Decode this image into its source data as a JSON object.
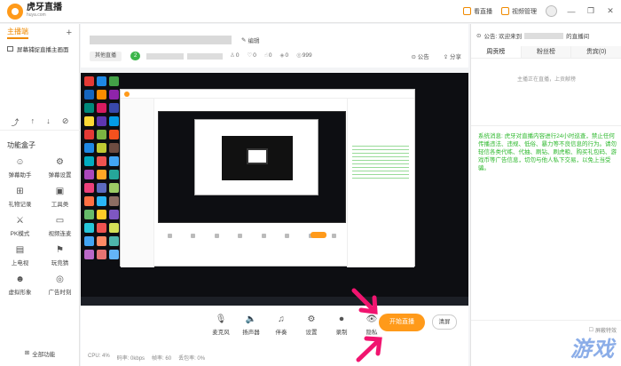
{
  "app": {
    "name": "虎牙直播",
    "url": "huya.com"
  },
  "topbar": {
    "my_live": "看直播",
    "video_manage": "视频管理",
    "win_minimize": "—",
    "win_restore": "❐",
    "win_close": "✕"
  },
  "sidebar": {
    "title": "主播端",
    "add": "+",
    "scene_label": "屏幕捕捉直播主画面",
    "tools": [
      "⤴",
      "↑",
      "↓",
      "⊘"
    ],
    "func_title": "功能盒子",
    "func_items": [
      {
        "label": "弹幕助手",
        "icon": "☺"
      },
      {
        "label": "弹幕设置",
        "icon": "⚙"
      },
      {
        "label": "礼物记录",
        "icon": "⊞"
      },
      {
        "label": "工具类",
        "icon": "▣"
      },
      {
        "label": "PK模式",
        "icon": "⚔"
      },
      {
        "label": "视频连麦",
        "icon": "▭"
      },
      {
        "label": "上电视",
        "icon": "▤"
      },
      {
        "label": "玩竞猜",
        "icon": "⚑"
      },
      {
        "label": "虚拟形象",
        "icon": "☻"
      },
      {
        "label": "广告时刻",
        "icon": "◎"
      }
    ],
    "all_funcs": "全部功能"
  },
  "info": {
    "edit": "编辑",
    "category": "其他直播",
    "level": "2",
    "stats": [
      "0",
      "0",
      "0",
      "0",
      "999"
    ],
    "notice_btn": "公告",
    "share_btn": "分享"
  },
  "toolbar": {
    "tools": [
      {
        "label": "麦克风",
        "icon": "🎙"
      },
      {
        "label": "扬声器",
        "icon": "🔈"
      },
      {
        "label": "伴奏",
        "icon": "♫"
      },
      {
        "label": "设置",
        "icon": "⚙"
      },
      {
        "label": "录制",
        "icon": "⏺"
      },
      {
        "label": "隐私",
        "icon": "👁"
      }
    ],
    "start_label": "开始直播",
    "clear_label": "清屏",
    "status": [
      "CPU: 4%",
      "码率: 0kbps",
      "帧率: 60",
      "丢包率: 0%"
    ]
  },
  "right": {
    "notice_prefix": "公告: 欢迎来到",
    "notice_suffix": "的直播间",
    "tabs": [
      "周贡榜",
      "粉丝榜",
      "贵宾(0)"
    ],
    "rank_empty": "主播正在直播，上贡献榜",
    "system_message": "系统消息: 虎牙对直播内容进行24小时巡查，禁止任何传播违法、违规、低俗、暴力等不良信息的行为。请勿轻信各类代练、代抽、刷钻、刷虎粮、购买礼包码、游戏币等广告信息，切勿与他人私下交易，以免上当受骗。",
    "shield": "屏蔽特效",
    "watermark": "游戏"
  }
}
